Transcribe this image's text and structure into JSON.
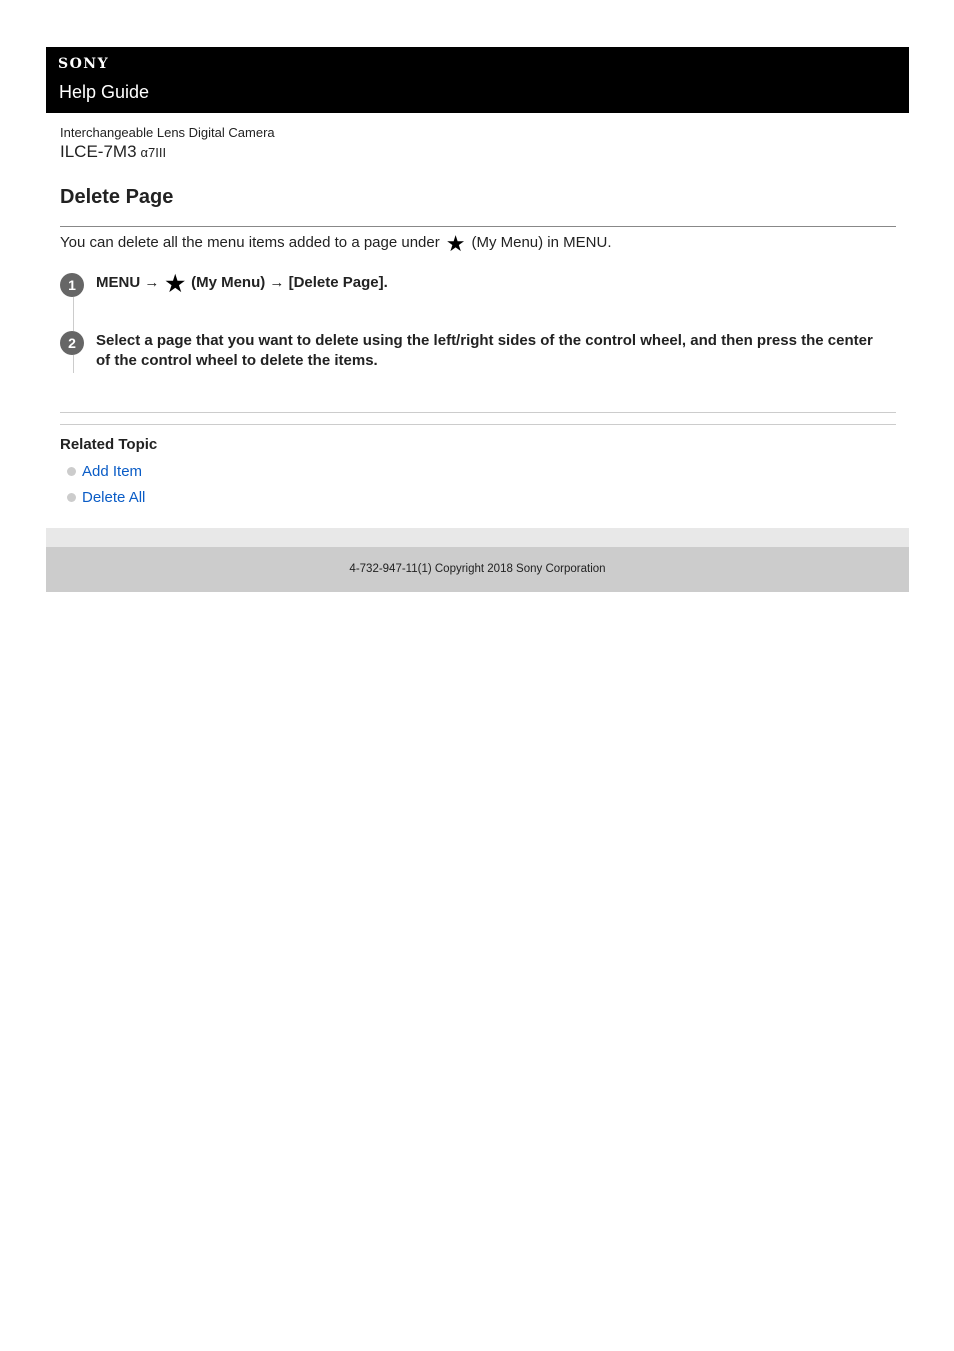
{
  "header": {
    "brand": "SONY",
    "title": "Help Guide"
  },
  "product": {
    "category": "Interchangeable Lens Digital Camera",
    "model": "ILCE-7M3",
    "model_alias": "α7III"
  },
  "page": {
    "title": "Delete Page",
    "intro_before": "You can delete all the menu items added to a page under",
    "intro_icon": "star-icon",
    "intro_after": "(My Menu) in MENU."
  },
  "steps": [
    {
      "number": "1",
      "text_before": "MENU →",
      "icon": "star-icon",
      "text_after": "(My Menu) → [Delete Page]."
    },
    {
      "number": "2",
      "text": "Select a page that you want to delete using the left/right sides of the control wheel, and then press the center of the control wheel to delete the items."
    }
  ],
  "related": {
    "heading": "Related Topic",
    "links": [
      "Add Item",
      "Delete All"
    ]
  },
  "footer": {
    "copyright": "4-732-947-11(1) Copyright 2018 Sony Corporation"
  }
}
